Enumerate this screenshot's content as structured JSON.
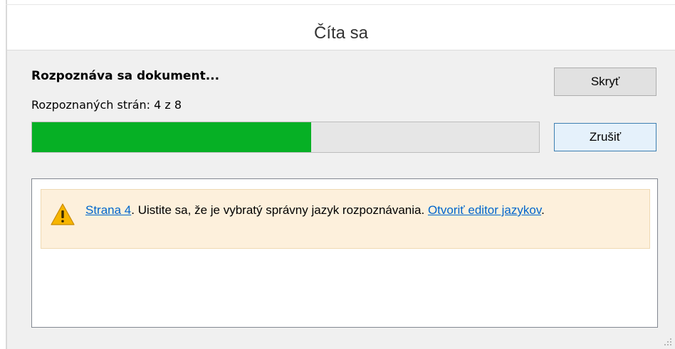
{
  "window": {
    "title": "Číta sa"
  },
  "status": {
    "heading": "Rozpoznáva sa dokument...",
    "pages_label": "Rozpoznaných strán: 4 z 8",
    "pages_done": 4,
    "pages_total": 8,
    "progress_fraction": 0.55
  },
  "buttons": {
    "hide_label": "Skryť",
    "cancel_label": "Zrušiť"
  },
  "log": {
    "warning": {
      "icon": "warning-icon",
      "page_link": "Strana 4",
      "message": ". Uistite sa, že je vybratý správny jazyk rozpoznávania. ",
      "editor_link": "Otvoriť editor jazykov",
      "end": "."
    }
  },
  "colors": {
    "progress": "#06b025",
    "warning_background": "#fdf0dc",
    "link": "#0066cc"
  }
}
